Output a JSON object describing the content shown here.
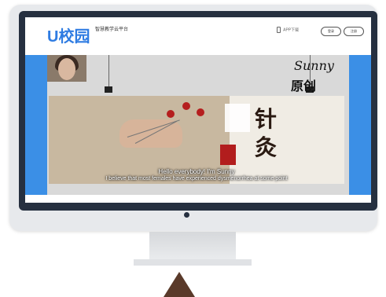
{
  "header": {
    "logo": "U校园",
    "platform_title": "智慧教学云平台",
    "platform_subtitle": "",
    "app_link": "APP下载",
    "login_button": "登录",
    "register_button": "注册"
  },
  "banner": {
    "sunny": "Sunny",
    "original": "原创",
    "subtitle_1": "Hello everybody! I'm Sunny",
    "subtitle_2": "I believe that most females have experienced dysmenorrhea at some point",
    "title_chars": [
      "针",
      "灸"
    ]
  },
  "colors": {
    "brand_blue": "#2f7ce2",
    "banner_blue": "#3b8fe6",
    "bezel": "#263040"
  }
}
